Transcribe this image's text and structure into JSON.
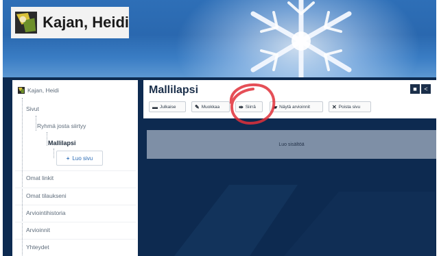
{
  "header": {
    "site_title": "Kajan, Heidi"
  },
  "sidebar": {
    "root_label": "Kajan, Heidi",
    "items": [
      {
        "label": "Sivut"
      },
      {
        "label": "Ryhmä josta siirtyy"
      },
      {
        "label": "Mallilapsi"
      },
      {
        "label": "Omat linkit"
      },
      {
        "label": "Omat tilaukseni"
      },
      {
        "label": "Arviointihistoria"
      },
      {
        "label": "Arvioinnit"
      },
      {
        "label": "Yhteydet"
      }
    ],
    "new_page_button": "Luo sivu"
  },
  "main": {
    "page_title": "Mallilapsi",
    "toolbar": [
      {
        "label": "Julkaise",
        "icon": "printer-icon"
      },
      {
        "label": "Muokkaa",
        "icon": "pencil-icon"
      },
      {
        "label": "Siirrä",
        "icon": "move-icon"
      },
      {
        "label": "Näytä arvioinnit",
        "icon": "assessment-icon"
      },
      {
        "label": "Poista sivu",
        "icon": "close-icon"
      }
    ],
    "content_placeholder": "Luo sisältöä"
  },
  "colors": {
    "header_blue": "#2e6fb7",
    "dark_navy": "#0d2a50",
    "annotation_red": "#e0303a",
    "content_bar": "#7e8fa6"
  }
}
